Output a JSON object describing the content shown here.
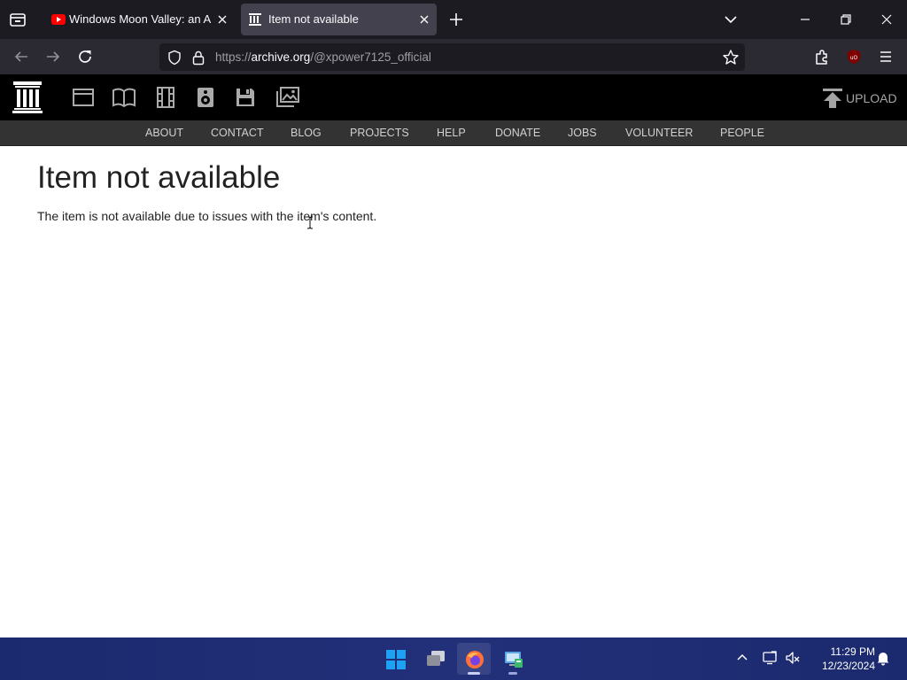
{
  "browser": {
    "tabs": [
      {
        "title": "Windows Moon Valley: an AMA",
        "favicon": "youtube-icon",
        "active": false
      },
      {
        "title": "Item not available",
        "favicon": "archive-icon",
        "active": true
      }
    ],
    "url": {
      "prefix": "https://",
      "host": "archive.org",
      "path": "/@xpower7125_official"
    }
  },
  "site": {
    "upload_label": "UPLOAD",
    "media_icons": [
      "web-icon",
      "texts-icon",
      "video-icon",
      "audio-icon",
      "software-icon",
      "images-icon"
    ],
    "nav": [
      "ABOUT",
      "CONTACT",
      "BLOG",
      "PROJECTS",
      "HELP",
      "DONATE",
      "JOBS",
      "VOLUNTEER",
      "PEOPLE"
    ]
  },
  "main": {
    "title": "Item not available",
    "message": "The item is not available due to issues with the item's content."
  },
  "taskbar": {
    "apps": [
      "start-icon",
      "task-view-icon",
      "firefox-icon",
      "control-panel-icon"
    ],
    "time": "11:29 PM",
    "date": "12/23/2024"
  },
  "colors": {
    "accent": "#0078d4",
    "ia_header": "#000000",
    "ia_nav": "#333333",
    "tab_active": "#42414d",
    "taskbar": "#1f2c74"
  }
}
